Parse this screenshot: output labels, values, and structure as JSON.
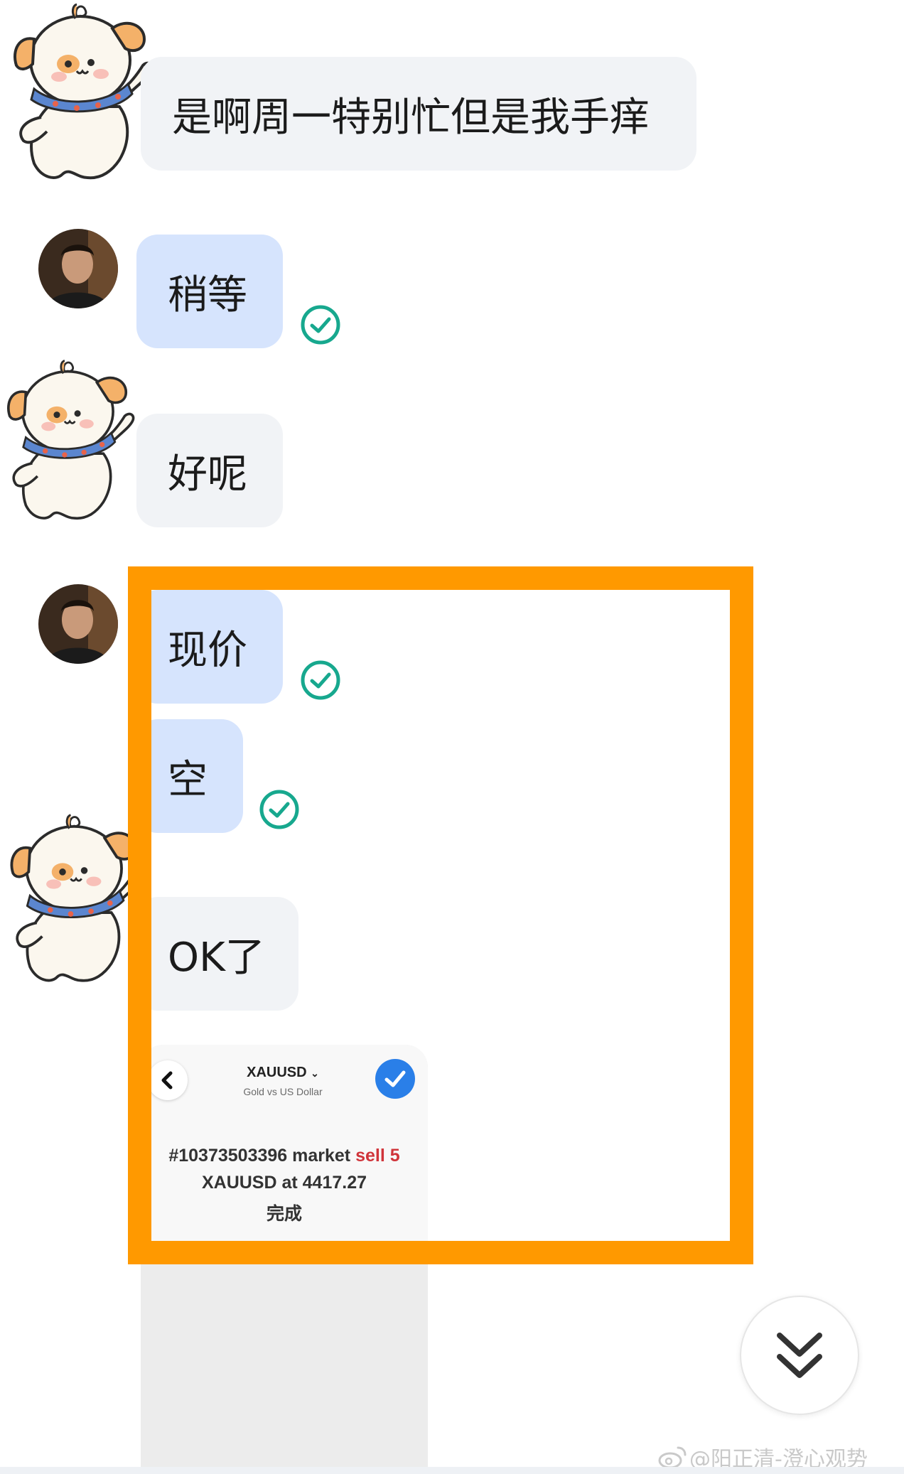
{
  "messages": [
    {
      "sender": "other",
      "text": "是啊周一特别忙但是我手痒"
    },
    {
      "sender": "me",
      "text": "稍等",
      "status": "sent-check-icon"
    },
    {
      "sender": "other",
      "text": "好呢"
    },
    {
      "sender": "me",
      "text": "现价",
      "status": "sent-check-icon"
    },
    {
      "sender": "me",
      "text": "空",
      "status": "sent-check-icon"
    },
    {
      "sender": "other",
      "text": "OK了"
    }
  ],
  "screenshot": {
    "title": "XAUUSD",
    "subtitle": "Gold vs US Dollar",
    "line1_a": "#10373503396 market",
    "line1_b": "sell 5",
    "line2": "XAUUSD at 4417.27",
    "line3": "完成"
  },
  "watermark": "@阳正清-澄心观势",
  "colors": {
    "highlight": "#ff9900",
    "my_bubble": "#d6e4fd",
    "other_bubble": "#f1f3f6",
    "check": "#17a88e"
  }
}
